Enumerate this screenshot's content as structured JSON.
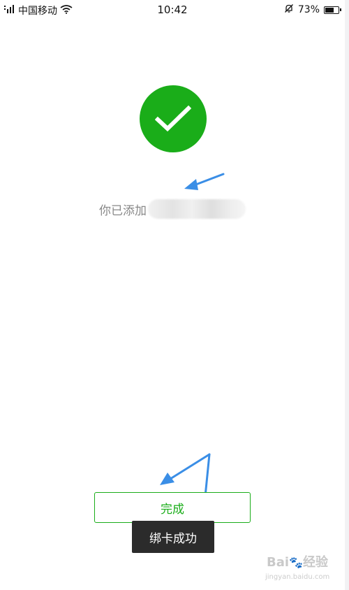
{
  "status_bar": {
    "carrier": "中国移动",
    "time": "10:42",
    "battery": "73%",
    "battery_level": 0.73
  },
  "main": {
    "added_text": "你已添加"
  },
  "actions": {
    "done_label": "完成"
  },
  "toast": {
    "text": "绑卡成功"
  },
  "watermark": {
    "brand": "Bai",
    "brand_suffix": "经验",
    "domain": "jingyan.baidu.com"
  },
  "colors": {
    "accent_green": "#1aad19",
    "annotation_arrow": "#3a8ee6",
    "toast_bg": "#2b2b2b"
  },
  "icons": {
    "success": "checkmark-icon",
    "wifi": "wifi-icon",
    "signal": "signal-icon",
    "mute": "bell-off-icon",
    "battery": "battery-icon"
  }
}
